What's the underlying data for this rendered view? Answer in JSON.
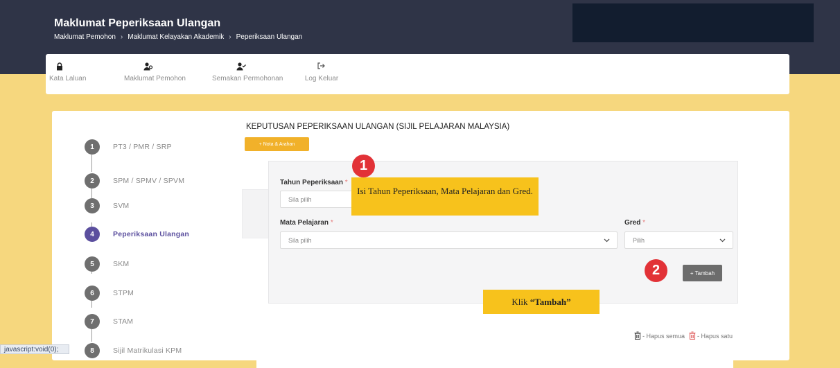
{
  "header": {
    "title": "Maklumat Peperiksaan Ulangan",
    "breadcrumb": [
      "Maklumat Pemohon",
      "Maklumat Kelayakan Akademik",
      "Peperiksaan Ulangan"
    ]
  },
  "nav": {
    "items": [
      {
        "label": "Kata Laluan",
        "icon": "lock-icon"
      },
      {
        "label": "Maklumat Pemohon",
        "icon": "user-group-icon"
      },
      {
        "label": "Semakan Permohonan",
        "icon": "user-check-icon"
      },
      {
        "label": "Log Keluar",
        "icon": "sign-out-icon"
      }
    ]
  },
  "steps": [
    {
      "num": "1",
      "label": "PT3 / PMR / SRP",
      "active": false
    },
    {
      "num": "2",
      "label": "SPM / SPMV / SPVM",
      "active": false
    },
    {
      "num": "3",
      "label": "SVM",
      "active": false
    },
    {
      "num": "4",
      "label": "Peperiksaan Ulangan",
      "active": true
    },
    {
      "num": "5",
      "label": "SKM",
      "active": false
    },
    {
      "num": "6",
      "label": "STPM",
      "active": false
    },
    {
      "num": "7",
      "label": "STAM",
      "active": false
    },
    {
      "num": "8",
      "label": "Sijil Matrikulasi KPM",
      "active": false
    }
  ],
  "section": {
    "title": "KEPUTUSAN PEPERIKSAAN ULANGAN (SIJIL PELAJARAN MALAYSIA)",
    "nota_button": "+ Nota & Arahan"
  },
  "form": {
    "tahun_label": "Tahun Peperiksaan",
    "tahun_value": "Sila pilih",
    "mata_label": "Mata Pelajaran",
    "mata_value": "Sila pilih",
    "gred_label": "Gred",
    "gred_value": "Pilih",
    "required_mark": "*",
    "tambah_button": "+ Tambah"
  },
  "annotations": {
    "badge1": "1",
    "badge2": "2",
    "callout1": "Isi Tahun Peperiksaan, Mata Pelajaran dan Gred.",
    "callout2_prefix": "Klik ",
    "callout2_bold": "“Tambah”"
  },
  "legend": {
    "hapus_semua": "- Hapus semua",
    "hapus_satu": "- Hapus satu"
  },
  "status_bar": "javascript:void(0);",
  "colors": {
    "header_bg": "#2f3447",
    "page_bg": "#f6d77e",
    "accent_purple": "#5b4f9e",
    "orange": "#f1b12a",
    "callout_yellow": "#f7c21c",
    "badge_red": "#e23237"
  }
}
